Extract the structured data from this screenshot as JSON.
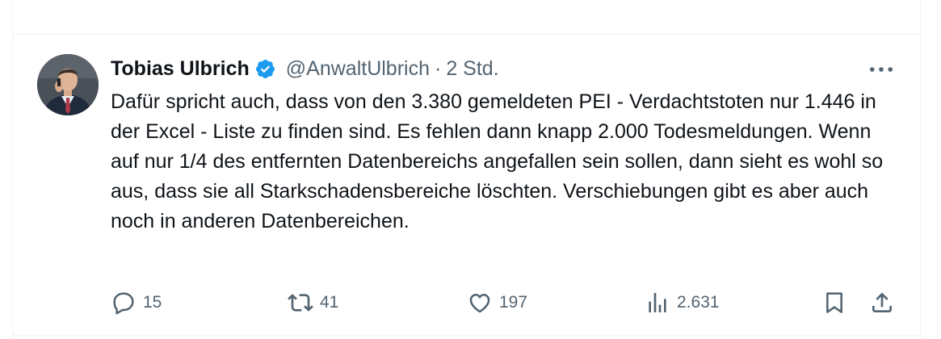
{
  "tweet": {
    "author_name": "Tobias Ulbrich",
    "handle": "@AnwaltUlbrich",
    "separator": "·",
    "time": "2 Std.",
    "text": "Dafür spricht auch, dass von den 3.380 gemeldeten PEI - Verdachtstoten nur 1.446 in der Excel - Liste zu finden sind. Es fehlen dann knapp 2.000 Todesmeldungen. Wenn auf nur 1/4 des entfernten Datenbereichs angefallen sein sollen, dann sieht es wohl so aus, dass sie all Starkschadensbereiche löschten. Verschiebungen gibt es aber auch noch in anderen Datenbereichen."
  },
  "actions": {
    "replies": "15",
    "retweets": "41",
    "likes": "197",
    "views": "2.631"
  },
  "colors": {
    "verified": "#1d9bf0",
    "secondary_text": "#536471",
    "primary_text": "#0f1419",
    "divider": "#eff3f4"
  },
  "icons": {
    "reply": "reply-icon",
    "retweet": "retweet-icon",
    "like": "heart-icon",
    "views": "views-icon",
    "bookmark": "bookmark-icon",
    "share": "share-icon",
    "more": "more-icon",
    "verified": "verified-badge-icon"
  }
}
